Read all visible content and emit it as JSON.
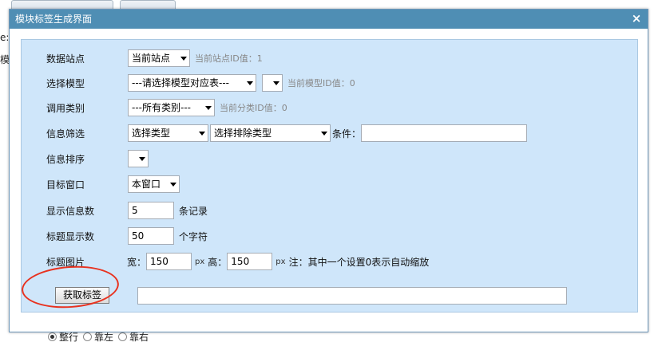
{
  "dialog": {
    "title": "模块标签生成界面",
    "close_glyph": "×"
  },
  "form": {
    "site": {
      "label": "数据站点",
      "value": "当前站点",
      "hint": "当前站点ID值：1"
    },
    "model": {
      "label": "选择模型",
      "value": "---请选择模型对应表---",
      "second_value": "",
      "hint": "当前模型ID值：0"
    },
    "category": {
      "label": "调用类别",
      "value": "---所有类别---",
      "hint": "当前分类ID值：0"
    },
    "filter": {
      "label": "信息筛选",
      "type_value": "选择类型",
      "exclude_value": "选择排除类型",
      "condition_label": "条件：",
      "condition_value": ""
    },
    "sort": {
      "label": "信息排序",
      "value": ""
    },
    "target": {
      "label": "目标窗口",
      "value": "本窗口"
    },
    "count": {
      "label": "显示信息数",
      "value": "5",
      "unit": "条记录"
    },
    "title_len": {
      "label": "标题显示数",
      "value": "50",
      "unit": "个字符"
    },
    "image": {
      "label": "标题图片",
      "width_label": "宽：",
      "width_value": "150",
      "px1": "px",
      "height_label": "高：",
      "height_value": "150",
      "px2": "px",
      "note": "注：其中一个设置0表示自动缩放"
    },
    "get_button": "获取标签",
    "result_value": ""
  },
  "background": {
    "left_char_1": "e:",
    "left_char_2": "模",
    "radios": [
      {
        "label": "整行",
        "checked": true
      },
      {
        "label": "靠左",
        "checked": false
      },
      {
        "label": "靠右",
        "checked": false
      }
    ]
  },
  "colors": {
    "titlebar": "#4f8eb4",
    "panel": "#cfe6fa",
    "annotation": "#e8321f"
  }
}
